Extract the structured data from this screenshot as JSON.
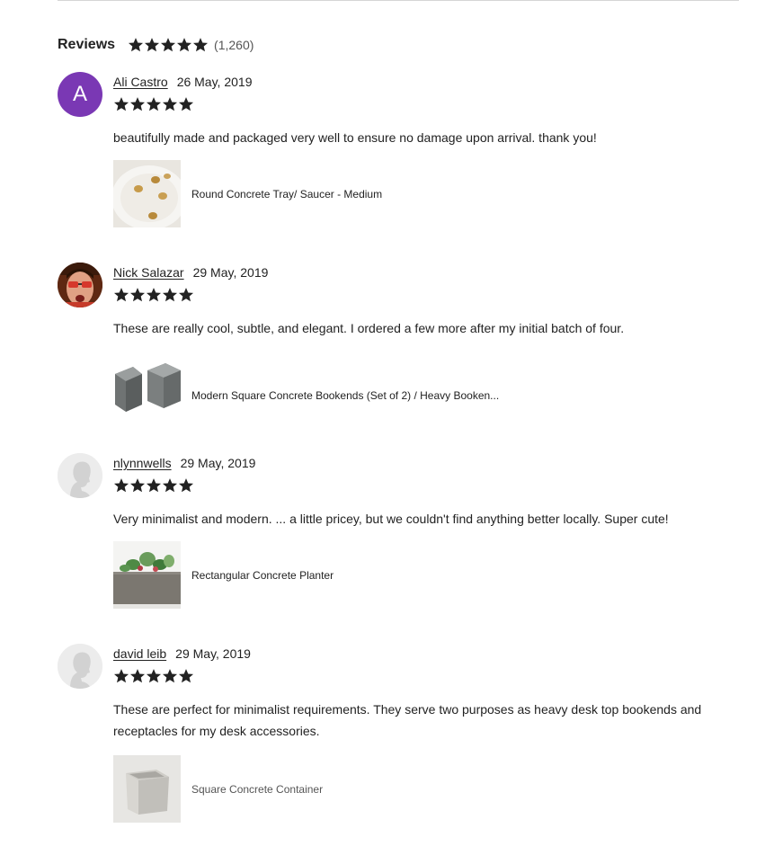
{
  "reviews_section": {
    "title": "Reviews",
    "rating_stars": 5,
    "count": "(1,260)"
  },
  "reviews": [
    {
      "avatar": {
        "type": "initial",
        "letter": "A",
        "color": "#7a38b4"
      },
      "name": "Ali Castro",
      "date": "26 May, 2019",
      "stars": 5,
      "text": "beautifully made and packaged very well to ensure no damage upon arrival. thank you!",
      "listing": {
        "title": "Round Concrete Tray/ Saucer - Medium",
        "thumb_icon": "round-tray-thumbnail"
      }
    },
    {
      "avatar": {
        "type": "photo",
        "icon": "user-photo-avatar"
      },
      "name": "Nick Salazar",
      "date": "29 May, 2019",
      "stars": 5,
      "text": "These are really cool, subtle, and elegant. I ordered a few more after my initial batch of four.",
      "listing": {
        "title": "Modern Square Concrete Bookends (Set of 2) / Heavy Booken...",
        "thumb_icon": "bookends-thumbnail"
      }
    },
    {
      "avatar": {
        "type": "generic",
        "icon": "default-user-avatar"
      },
      "name": "nlynnwells",
      "date": "29 May, 2019",
      "stars": 5,
      "text": "Very minimalist and modern. ... a little pricey, but we couldn't find anything better locally. Super cute!",
      "listing": {
        "title": "Rectangular Concrete Planter",
        "thumb_icon": "planter-thumbnail"
      }
    },
    {
      "avatar": {
        "type": "generic",
        "icon": "default-user-avatar"
      },
      "name": "david leib",
      "date": "29 May, 2019",
      "stars": 5,
      "text": "These are perfect for minimalist requirements. They serve two purposes as heavy desk top bookends and receptacles for my desk accessories.",
      "listing": {
        "title": "Square Concrete Container",
        "thumb_icon": "container-thumbnail"
      }
    }
  ]
}
